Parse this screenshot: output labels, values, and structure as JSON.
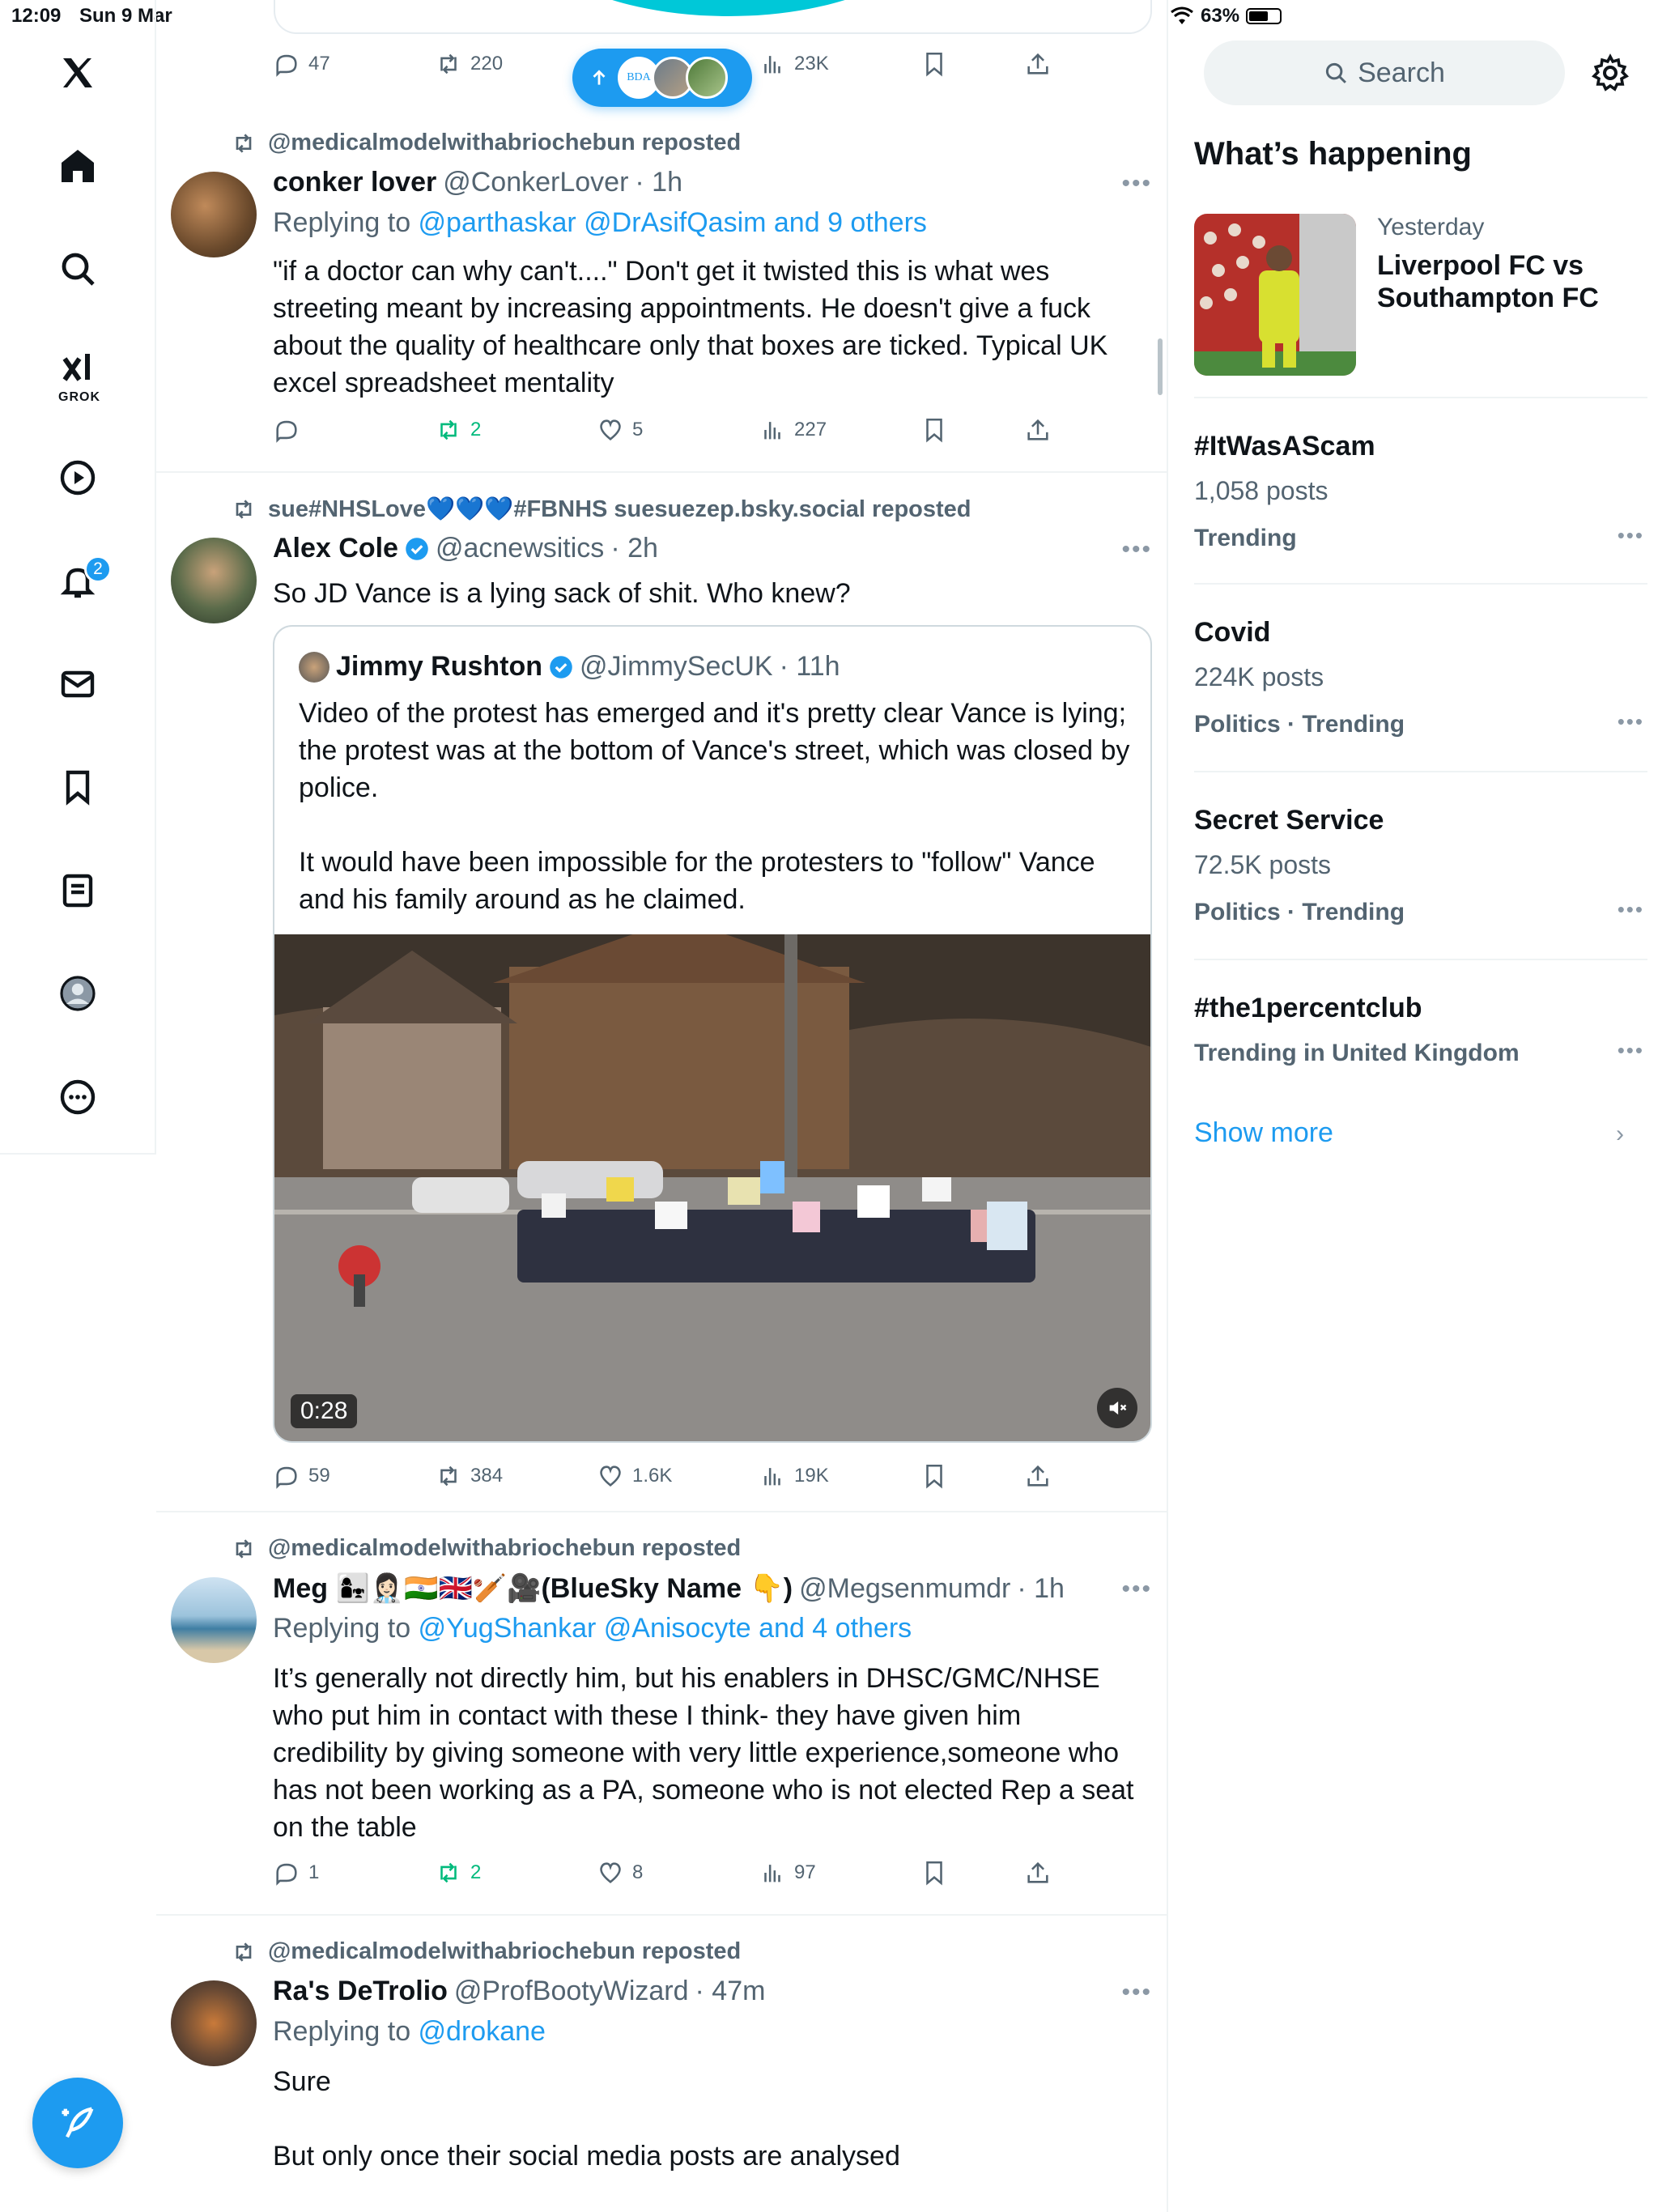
{
  "status_bar": {
    "time": "12:09",
    "date": "Sun 9 Mar",
    "battery": "63%",
    "battery_level": 0.63
  },
  "nav": {
    "items": [
      "home",
      "explore",
      "grok",
      "videos",
      "notifications",
      "messages",
      "bookmarks",
      "lists",
      "profile",
      "more"
    ],
    "grok_label": "GROK",
    "notification_count": "2"
  },
  "top_post": {
    "pill_text": "BDA",
    "actions": {
      "replies": "47",
      "reposts": "220",
      "views": "23K"
    }
  },
  "posts": [
    {
      "repost_by": "@medicalmodelwithabriochebun reposted",
      "name": "conker lover",
      "handle": "@ConkerLover",
      "time": "· 1h",
      "reply_prefix": "Replying to ",
      "reply_links": "@parthaskar @DrAsifQasim and 9 others",
      "text": "\"if a doctor can why can't....\" Don't get it twisted this is what wes streeting meant by increasing appointments. He doesn't give a fuck about the quality of healthcare only that boxes are ticked. Typical UK excel spreadsheet mentality",
      "actions": {
        "replies": "",
        "reposts": "2",
        "likes": "5",
        "views": "227"
      }
    },
    {
      "repost_by": "sue#NHSLove💙💙💙#FBNHS suesuezep.bsky.social reposted",
      "name": "Alex Cole",
      "handle": "@acnewsitics",
      "time": "· 2h",
      "text": "So JD Vance is a lying sack of shit. Who knew?",
      "quote": {
        "name": "Jimmy Rushton",
        "handle": "@JimmySecUK",
        "time": "· 11h",
        "text": "Video of the protest has emerged and it's pretty clear Vance is lying; the protest was at the bottom of Vance's street, which was closed by police.\n\nIt would have been impossible for the protesters to \"follow\" Vance and his family around as he claimed.",
        "video_duration": "0:28"
      },
      "actions": {
        "replies": "59",
        "reposts": "384",
        "likes": "1.6K",
        "views": "19K"
      }
    },
    {
      "repost_by": "@medicalmodelwithabriochebun reposted",
      "name": "Meg 👩‍👧👩🏻‍⚕️🇮🇳🇬🇧🏏🎥(BlueSky Name 👇)",
      "handle": "@Megsenmumdr",
      "time": "· 1h",
      "reply_prefix": "Replying to ",
      "reply_links": "@YugShankar @Anisocyte and 4 others",
      "text": "It’s generally not directly him, but his enablers in DHSC/GMC/NHSE who put him in contact with these I think- they have given him credibility by giving someone with very little experience,someone who has not been working as a PA, someone who is not elected Rep a seat on the table",
      "actions": {
        "replies": "1",
        "reposts": "2",
        "likes": "8",
        "views": "97"
      }
    },
    {
      "repost_by": "@medicalmodelwithabriochebun reposted",
      "name": "Ra's DeTrolio",
      "handle": "@ProfBootyWizard",
      "time": "· 47m",
      "reply_prefix": "Replying to ",
      "reply_links": "@drokane",
      "text": "Sure\n\nBut only once their social media posts are analysed"
    }
  ],
  "sidebar": {
    "search_placeholder": "Search",
    "title": "What’s happening",
    "featured": {
      "when": "Yesterday",
      "title": "Liverpool FC vs Southampton FC"
    },
    "trends": [
      {
        "name": "#ItWasAScam",
        "count": "1,058 posts",
        "context": "Trending"
      },
      {
        "name": "Covid",
        "count": "224K posts",
        "context": "Politics · Trending"
      },
      {
        "name": "Secret Service",
        "count": "72.5K posts",
        "context": "Politics · Trending"
      },
      {
        "name": "#the1percentclub",
        "count": "",
        "context": "Trending in United Kingdom"
      }
    ],
    "show_more": "Show more"
  },
  "colors": {
    "accent": "#1d9bf0",
    "repost_green": "#00ba7c",
    "secondary_text": "#536471"
  }
}
